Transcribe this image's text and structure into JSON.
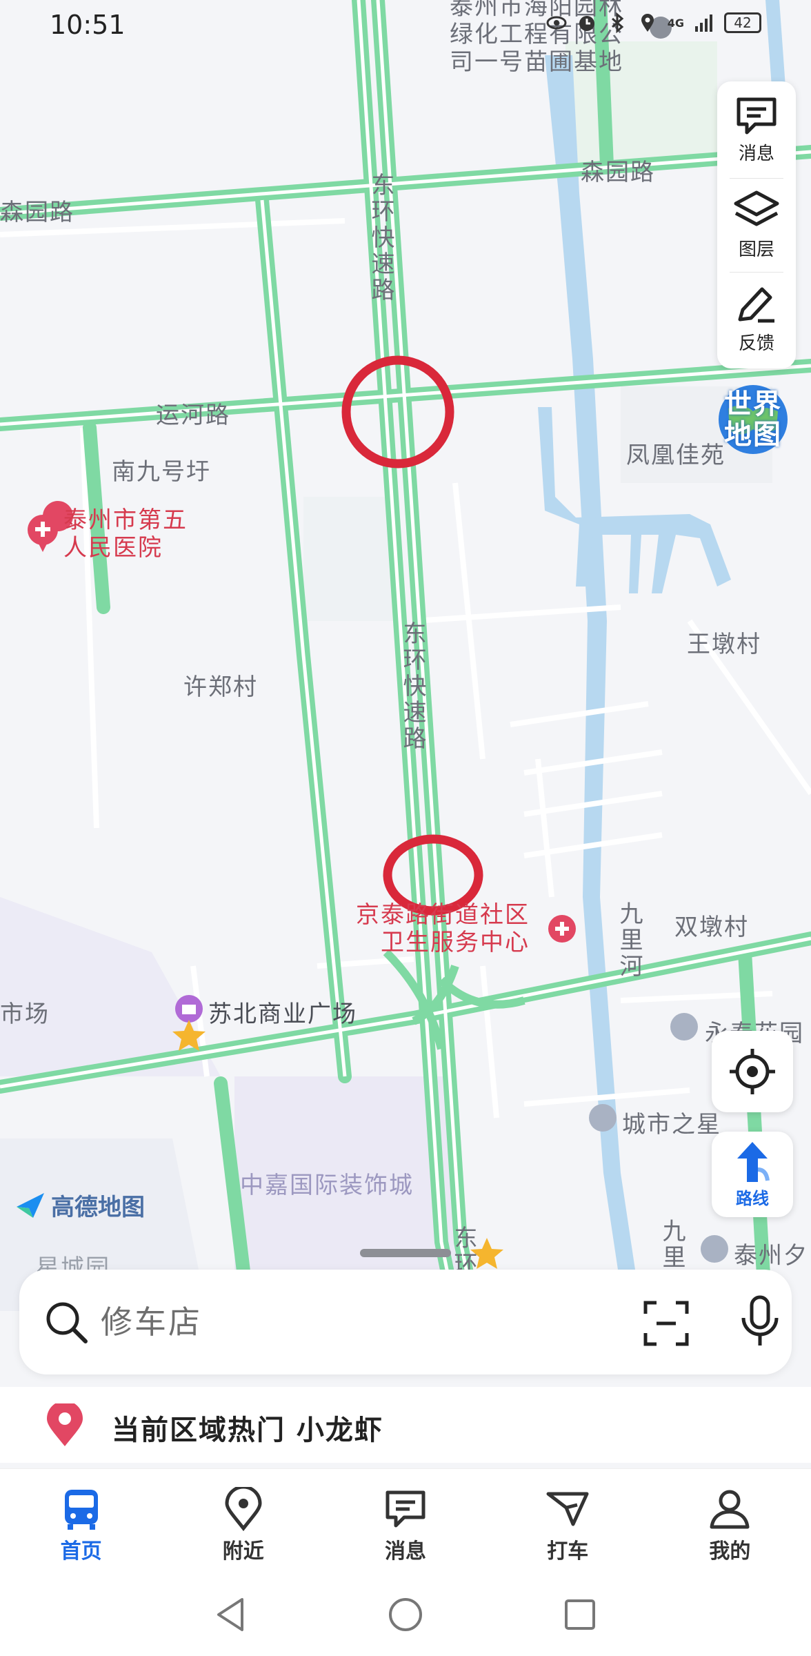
{
  "status_bar": {
    "time": "10:51",
    "network": "4G",
    "battery": "42"
  },
  "map": {
    "roads": {
      "senyuan_left": "森园路",
      "senyuan_right": "森园路",
      "yunhe": "运河路",
      "donghuan_upper": "东环快速路",
      "donghuan_lower": "东环快速路",
      "donghuan_bottom": "东环",
      "jiuli_river": "九里河",
      "jiuli_bottom": "九里"
    },
    "places": {
      "top_poi": "泰州市海阳园林\n绿化工程有限公\n司一号苗圃基地",
      "nanjiu": "南九号圩",
      "fenghuang": "凤凰佳苑",
      "hospital": "泰州市第五\n人民医院",
      "wangdun": "王墩村",
      "xuzheng": "许郑村",
      "health_center": "京泰路街道社区\n卫生服务中心",
      "shuangdun": "双墩村",
      "market": "市场",
      "subei": "苏北商业广场",
      "yongtai": "永泰花园",
      "chengshi": "城市之星",
      "zhongjia": "中嘉国际装饰城",
      "taizhou_right": "泰州夕",
      "xingcheng": "星城园"
    },
    "world_map_badge": "世界地图",
    "brand": "高德地图"
  },
  "right_tools": {
    "message": "消息",
    "layers": "图层",
    "feedback": "反馈"
  },
  "route_button": {
    "label": "路线"
  },
  "search": {
    "placeholder": "修车店"
  },
  "hot_tip": {
    "text": "当前区域热门 小龙虾"
  },
  "bottom_nav": {
    "home": "首页",
    "nearby": "附近",
    "message": "消息",
    "taxi": "打车",
    "mine": "我的"
  },
  "colors": {
    "accent": "#1b6ae6",
    "road": "#7fd9a3",
    "marker": "#d63a4e",
    "water": "#b7d8f0"
  }
}
